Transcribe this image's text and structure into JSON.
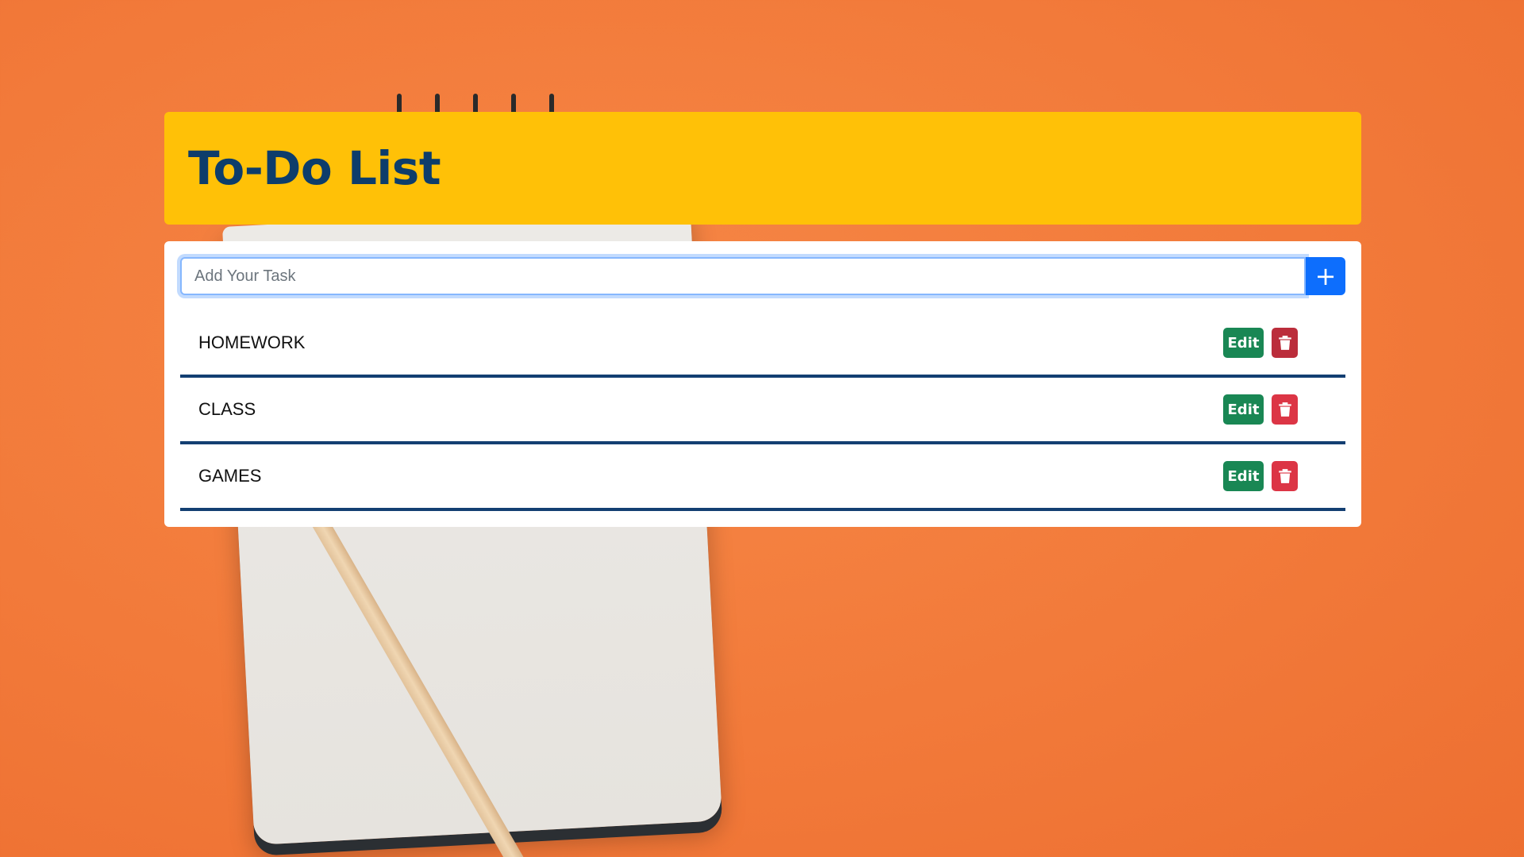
{
  "header": {
    "title": "To-Do List"
  },
  "input": {
    "placeholder": "Add Your Task",
    "value": ""
  },
  "add_button": {
    "label": "+",
    "color": "#0d6efd"
  },
  "tasks": [
    {
      "label": "HOMEWORK",
      "edit_label": "Edit",
      "delete_icon": "trash-icon"
    },
    {
      "label": "CLASS",
      "edit_label": "Edit",
      "delete_icon": "trash-icon"
    },
    {
      "label": "GAMES",
      "edit_label": "Edit",
      "delete_icon": "trash-icon"
    }
  ],
  "colors": {
    "header_bg": "#ffc107",
    "title": "#0d3d6b",
    "edit": "#198754",
    "delete": "#dc3545",
    "divider": "#133f72"
  }
}
